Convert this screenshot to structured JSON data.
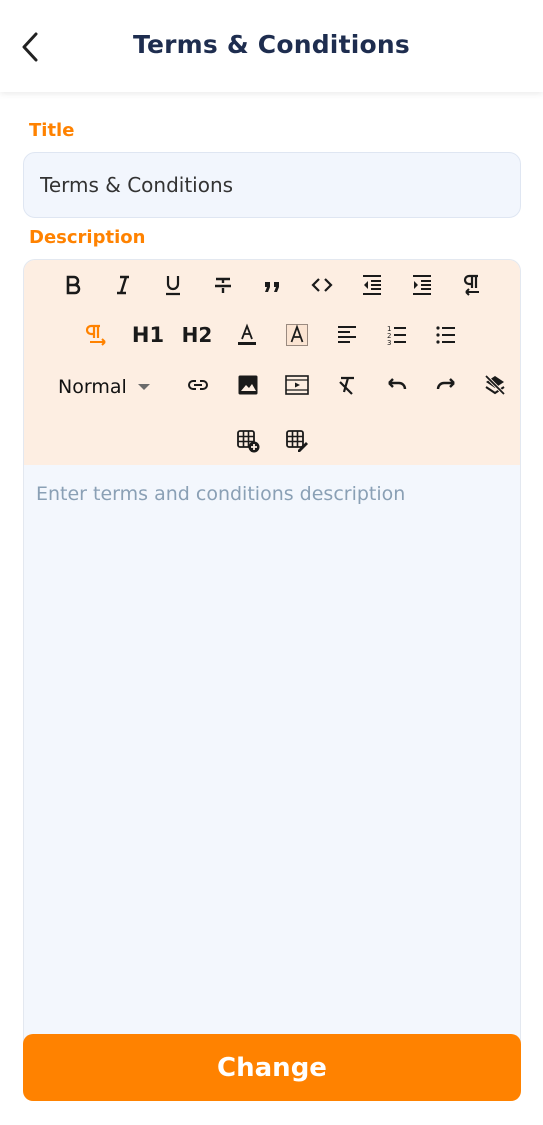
{
  "header": {
    "title": "Terms & Conditions",
    "back_icon": "chevron-left-icon"
  },
  "form": {
    "title_label": "Title",
    "title_value": "Terms & Conditions",
    "description_label": "Description",
    "description_placeholder": "Enter terms and conditions description"
  },
  "toolbar": {
    "h1_label": "H1",
    "h2_label": "H2",
    "style_value": "Normal",
    "icons": [
      "bold-icon",
      "italic-icon",
      "underline-icon",
      "strikethrough-icon",
      "quote-icon",
      "code-icon",
      "outdent-icon",
      "indent-icon",
      "paragraph-direction-icon",
      "paragraph-direction-rtl-icon",
      "text-color-icon",
      "background-color-icon",
      "align-left-icon",
      "ordered-list-icon",
      "bullet-list-icon",
      "link-icon",
      "image-icon",
      "video-icon",
      "clear-format-icon",
      "undo-icon",
      "redo-icon",
      "clear-all-icon",
      "table-add-icon",
      "table-edit-icon"
    ]
  },
  "actions": {
    "change_label": "Change"
  },
  "colors": {
    "accent": "#ff8200",
    "title": "#1e2d4f",
    "toolbar_bg": "#fdeee2",
    "field_bg": "#f2f6fd"
  }
}
